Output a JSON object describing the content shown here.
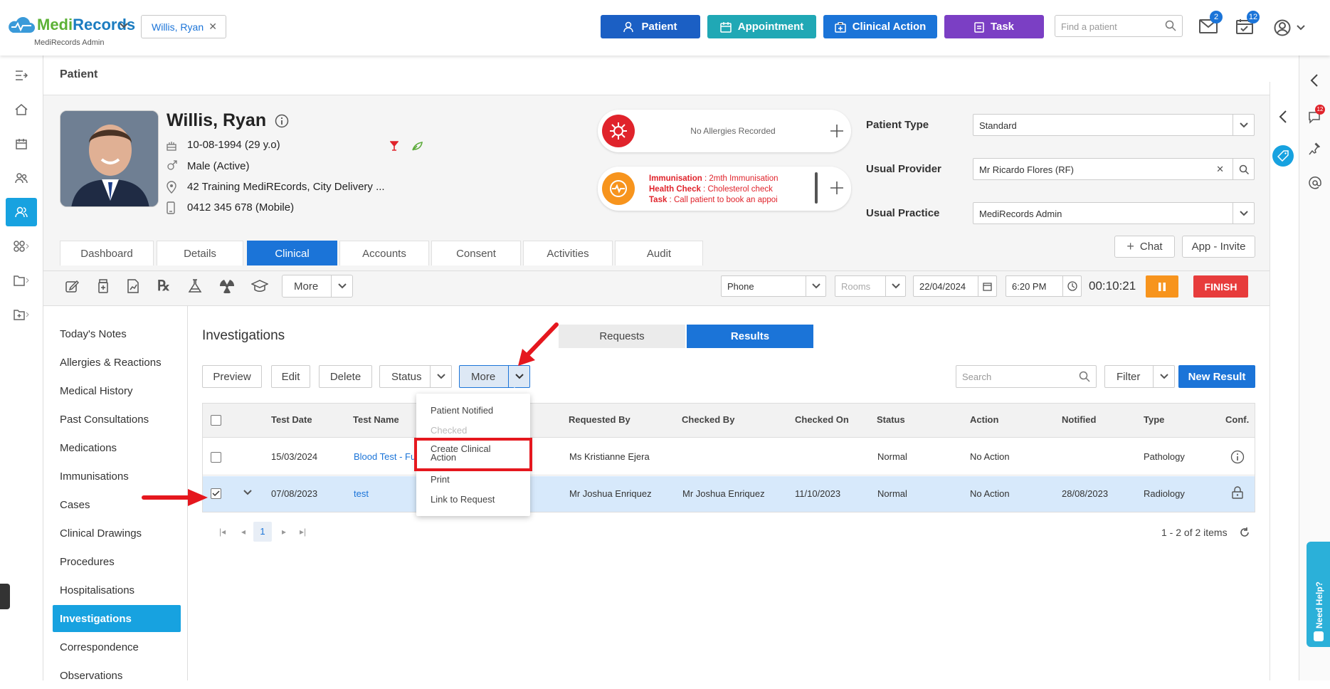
{
  "topbar": {
    "logo_prefix": "Medi",
    "logo_suffix": "Records",
    "logo_sub": "MediRecords Admin",
    "patient_chip": "Willis, Ryan",
    "btn_patient": "Patient",
    "btn_appointment": "Appointment",
    "btn_clinical_action": "Clinical Action",
    "btn_task": "Task",
    "find_placeholder": "Find a patient",
    "mail_badge": "2",
    "calendar_badge": "12"
  },
  "page_title": "Patient",
  "patient": {
    "name": "Willis, Ryan",
    "dob": "10-08-1994 (29 y.o)",
    "gender": "Male (Active)",
    "address": "42 Training MediREcords, City Delivery ...",
    "phone": "0412 345 678 (Mobile)"
  },
  "allergy": {
    "text": "No Allergies Recorded"
  },
  "reminders": [
    {
      "label": "Immunisation",
      "text": " : 2mth Immunisation"
    },
    {
      "label": "Health Check",
      "text": " : Cholesterol check"
    },
    {
      "label": "Task",
      "text": " : Call patient to book an appoi"
    }
  ],
  "fields": {
    "patient_type_label": "Patient Type",
    "patient_type_value": "Standard",
    "usual_provider_label": "Usual Provider",
    "usual_provider_value": "Mr Ricardo Flores (RF)",
    "usual_practice_label": "Usual Practice",
    "usual_practice_value": "MediRecords Admin"
  },
  "tabs": [
    "Dashboard",
    "Details",
    "Clinical",
    "Accounts",
    "Consent",
    "Activities",
    "Audit"
  ],
  "header_buttons": {
    "chat": "Chat",
    "app_invite": "App - Invite"
  },
  "toolbar": {
    "more": "More",
    "phone": "Phone",
    "rooms": "Rooms",
    "date": "22/04/2024",
    "time": "6:20 PM",
    "timer": "00:10:21",
    "finish": "FINISH"
  },
  "sidebar": [
    "Today's Notes",
    "Allergies & Reactions",
    "Medical History",
    "Past Consultations",
    "Medications",
    "Immunisations",
    "Cases",
    "Clinical Drawings",
    "Procedures",
    "Hospitalisations",
    "Investigations",
    "Correspondence",
    "Observations"
  ],
  "investigations": {
    "title": "Investigations",
    "seg_requests": "Requests",
    "seg_results": "Results",
    "btn_preview": "Preview",
    "btn_edit": "Edit",
    "btn_delete": "Delete",
    "btn_status": "Status",
    "btn_more": "More",
    "search_placeholder": "Search",
    "btn_filter": "Filter",
    "btn_new_result": "New Result"
  },
  "menu": [
    "Patient Notified",
    "Checked",
    "Create Clinical Action",
    "Print",
    "Link to Request"
  ],
  "table": {
    "headers": [
      "Test Date",
      "Test Name",
      "Requested By",
      "Checked By",
      "Checked On",
      "Status",
      "Action",
      "Notified",
      "Type",
      "Conf."
    ],
    "rows": [
      {
        "test_date": "15/03/2024",
        "test_name": "Blood Test - Fu",
        "requested_by": "Ms Kristianne Ejera",
        "checked_by": "",
        "checked_on": "",
        "status": "Normal",
        "action": "No Action",
        "notified": "",
        "type": "Pathology"
      },
      {
        "test_date": "07/08/2023",
        "test_name": "test",
        "requested_by": "Mr Joshua Enriquez",
        "checked_by": "Mr Joshua Enriquez",
        "checked_on": "11/10/2023",
        "status": "Normal",
        "action": "No Action",
        "notified": "28/08/2023",
        "type": "Radiology"
      }
    ]
  },
  "pager": {
    "page": "1",
    "summary": "1 - 2 of 2 items"
  },
  "rail": {
    "chat_badge": "12",
    "need_help": "Need Help?"
  }
}
